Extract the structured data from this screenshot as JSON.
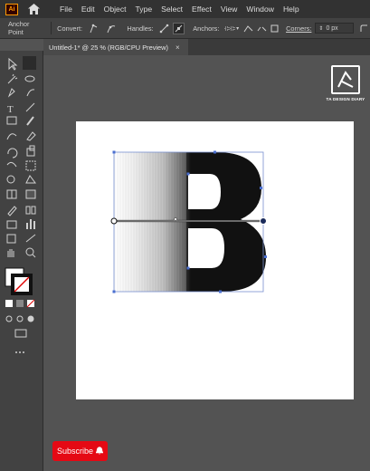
{
  "app": {
    "logo_text": "Ai"
  },
  "menu": {
    "items": [
      "File",
      "Edit",
      "Object",
      "Type",
      "Select",
      "Effect",
      "View",
      "Window",
      "Help"
    ]
  },
  "controlbar": {
    "anchor_point_label": "Anchor Point",
    "convert_label": "Convert:",
    "handles_label": "Handles:",
    "anchors_label": "Anchors:",
    "corners_label": "Corners:",
    "corners_value": "0 px"
  },
  "document_tab": {
    "title": "Untitled-1* @ 25 % (RGB/CPU Preview)",
    "close_glyph": "×"
  },
  "watermark": {
    "text": "TA DESIGN DIARY"
  },
  "artwork": {
    "glyph": "B",
    "fill_color": "#111111",
    "gradient_direction": "left-fade"
  },
  "subscribe_button": {
    "label": "Subscribe",
    "color": "#e50914"
  },
  "colors": {
    "menubar": "#323232",
    "panel": "#424242",
    "canvas": "#535353",
    "artboard": "#ffffff",
    "accent_ai": "#ff9a00",
    "selection": "#4a6fd0"
  },
  "toolbar": {
    "tools": [
      "selection-tool",
      "direct-selection-tool",
      "magic-wand-tool",
      "lasso-tool",
      "pen-tool",
      "curvature-tool",
      "type-tool",
      "line-tool",
      "rectangle-tool",
      "paintbrush-tool",
      "shaper-tool",
      "eraser-tool",
      "rotate-tool",
      "scale-tool",
      "warp-tool",
      "free-transform-tool",
      "shape-builder-tool",
      "perspective-grid-tool",
      "mesh-tool",
      "gradient-tool",
      "eyedropper-tool",
      "blend-tool",
      "symbol-sprayer-tool",
      "column-graph-tool",
      "artboard-tool",
      "slice-tool",
      "hand-tool",
      "zoom-tool"
    ]
  }
}
